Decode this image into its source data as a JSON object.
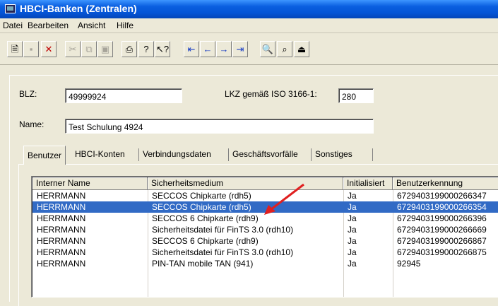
{
  "window": {
    "title": "HBCI-Banken (Zentralen)"
  },
  "menu": [
    "Datei",
    "Bearbeiten",
    "Ansicht",
    "Hilfe"
  ],
  "toolbar": {
    "buttons": [
      {
        "icon": "new-document-icon",
        "glyph": "🗎",
        "enabled": true
      },
      {
        "icon": "save-icon",
        "glyph": "▪",
        "enabled": false
      },
      {
        "icon": "delete-icon",
        "glyph": "✕",
        "enabled": true,
        "color": "#c00000"
      },
      {
        "icon": "cut-icon",
        "glyph": "✂",
        "enabled": false
      },
      {
        "icon": "copy-icon",
        "glyph": "⧉",
        "enabled": false
      },
      {
        "icon": "paste-icon",
        "glyph": "▣",
        "enabled": false
      },
      {
        "icon": "print-icon",
        "glyph": "⎙",
        "enabled": true
      },
      {
        "icon": "help-icon",
        "glyph": "?",
        "enabled": true
      },
      {
        "icon": "context-help-icon",
        "glyph": "↖?",
        "enabled": true
      },
      {
        "icon": "first-record-icon",
        "glyph": "⇤",
        "enabled": true,
        "color": "#1a3fc4"
      },
      {
        "icon": "previous-record-icon",
        "glyph": "←",
        "enabled": true,
        "color": "#1a3fc4"
      },
      {
        "icon": "next-record-icon",
        "glyph": "→",
        "enabled": true,
        "color": "#1a3fc4"
      },
      {
        "icon": "last-record-icon",
        "glyph": "⇥",
        "enabled": true,
        "color": "#1a3fc4"
      },
      {
        "icon": "find-icon",
        "glyph": "🔍",
        "enabled": true
      },
      {
        "icon": "find-next-icon",
        "glyph": "⌕",
        "enabled": true
      },
      {
        "icon": "exit-icon",
        "glyph": "⏏",
        "enabled": true
      }
    ]
  },
  "form": {
    "blz_label": "BLZ:",
    "blz_value": "49999924",
    "lkz_label": "LKZ gemäß ISO 3166-1:",
    "lkz_value": "280",
    "name_label": "Name:",
    "name_value": "Test Schulung 4924"
  },
  "tabs": [
    "Benutzer",
    "HBCI-Konten",
    "Verbindungsdaten",
    "Geschäftsvorfälle",
    "Sonstiges"
  ],
  "table": {
    "columns": [
      "Interner Name",
      "Sicherheitsmedium",
      "Initialisiert",
      "Benutzerkennung"
    ],
    "rows": [
      [
        "HERRMANN",
        "SECCOS Chipkarte (rdh5)",
        "Ja",
        "6729403199000266347"
      ],
      [
        "HERRMANN",
        "SECCOS Chipkarte (rdh5)",
        "Ja",
        "6729403199000266354"
      ],
      [
        "HERRMANN",
        "SECCOS 6 Chipkarte (rdh9)",
        "Ja",
        "6729403199000266396"
      ],
      [
        "HERRMANN",
        "Sicherheitsdatei für FinTS 3.0 (rdh10)",
        "Ja",
        "6729403199000266669"
      ],
      [
        "HERRMANN",
        "SECCOS 6 Chipkarte (rdh9)",
        "Ja",
        "6729403199000266867"
      ],
      [
        "HERRMANN",
        "Sicherheitsdatei für FinTS 3.0 (rdh10)",
        "Ja",
        "6729403199000266875"
      ],
      [
        "HERRMANN",
        "PIN-TAN mobile TAN (941)",
        "Ja",
        "92945"
      ]
    ],
    "selected_row": 1
  },
  "colors": {
    "selection": "#316ac5",
    "annotation_arrow": "#e02020",
    "titlebar": "#0a5fe0"
  }
}
